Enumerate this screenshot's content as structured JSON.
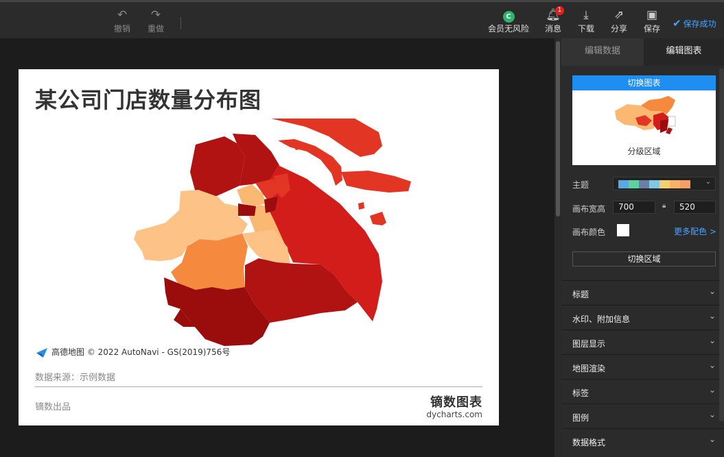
{
  "toolbar": {
    "undo_label": "撤销",
    "redo_label": "重做",
    "vip_label": "会员无风险",
    "vip_icon_letter": "C",
    "messages_label": "消息",
    "messages_badge": "1",
    "download_label": "下载",
    "share_label": "分享",
    "save_label": "保存",
    "save_status": "保存成功"
  },
  "chart": {
    "title": "某公司门店数量分布图",
    "map_credit": "© 2022 AutoNavi - GS(2019)756号",
    "map_logo_text": "高德地图",
    "source": "数据来源：示例数据",
    "footer_left": "镝数出品",
    "brand_name": "镝数图表",
    "brand_url": "dycharts.com"
  },
  "panel": {
    "tab_data": "编辑数据",
    "tab_chart": "编辑图表",
    "preview_header": "切换图表",
    "preview_label": "分级区域",
    "theme_label": "主题",
    "theme_colors": [
      "#5aa9e6",
      "#5fd0a0",
      "#6a7fa8",
      "#7ec8e3",
      "#f4d06f",
      "#f7b267",
      "#f79d65"
    ],
    "size_label": "画布宽高",
    "width_value": "700",
    "height_value": "520",
    "bg_color_label": "画布颜色",
    "more_colors": "更多配色 >",
    "switch_region": "切换区域",
    "sections": [
      "标题",
      "水印、附加信息",
      "图层显示",
      "地图渲染",
      "标签",
      "图例",
      "数据格式"
    ]
  },
  "colors": {
    "darkest": "#9b0c0c",
    "dark": "#b11212",
    "mid": "#d21d1b",
    "bright": "#e33524",
    "orange": "#f58a3e",
    "light": "#fbb872",
    "lightest": "#fdc285",
    "accent": "#1e8ff0"
  }
}
